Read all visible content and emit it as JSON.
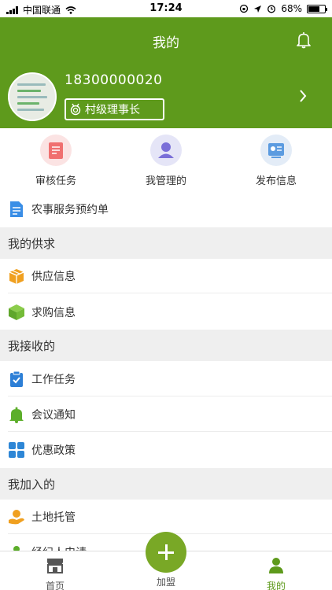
{
  "status_bar": {
    "carrier": "中国联通",
    "time": "17:24",
    "battery": "68%",
    "battery_level": 0.68
  },
  "header": {
    "title": "我的",
    "phone": "18300000020",
    "role": "村级理事长"
  },
  "quick_actions": [
    {
      "label": "审核任务",
      "icon": "review-task-icon",
      "color": "#fbe3e3"
    },
    {
      "label": "我管理的",
      "icon": "manage-user-icon",
      "color": "#e5e5f7"
    },
    {
      "label": "发布信息",
      "icon": "publish-info-icon",
      "color": "#e3ecf7"
    }
  ],
  "service_order": {
    "label": "农事服务预约单",
    "icon": "document-icon"
  },
  "sections": {
    "supply": {
      "title": "我的供求",
      "items": [
        {
          "label": "供应信息",
          "icon": "supply-box-icon"
        },
        {
          "label": "求购信息",
          "icon": "purchase-cube-icon"
        }
      ]
    },
    "received": {
      "title": "我接收的",
      "items": [
        {
          "label": "工作任务",
          "icon": "clipboard-check-icon"
        },
        {
          "label": "会议通知",
          "icon": "bell-icon"
        },
        {
          "label": "优惠政策",
          "icon": "grid-icon"
        }
      ]
    },
    "joined": {
      "title": "我加入的",
      "items": [
        {
          "label": "土地托管",
          "icon": "land-hand-icon"
        },
        {
          "label": "经纪人申请",
          "icon": "person-icon"
        }
      ]
    }
  },
  "tabbar": {
    "home": "首页",
    "join": "加盟",
    "mine": "我的"
  },
  "colors": {
    "header_green": "#5e9a1c",
    "active_tab": "#5e9a1c",
    "fab_green": "#79a826"
  }
}
